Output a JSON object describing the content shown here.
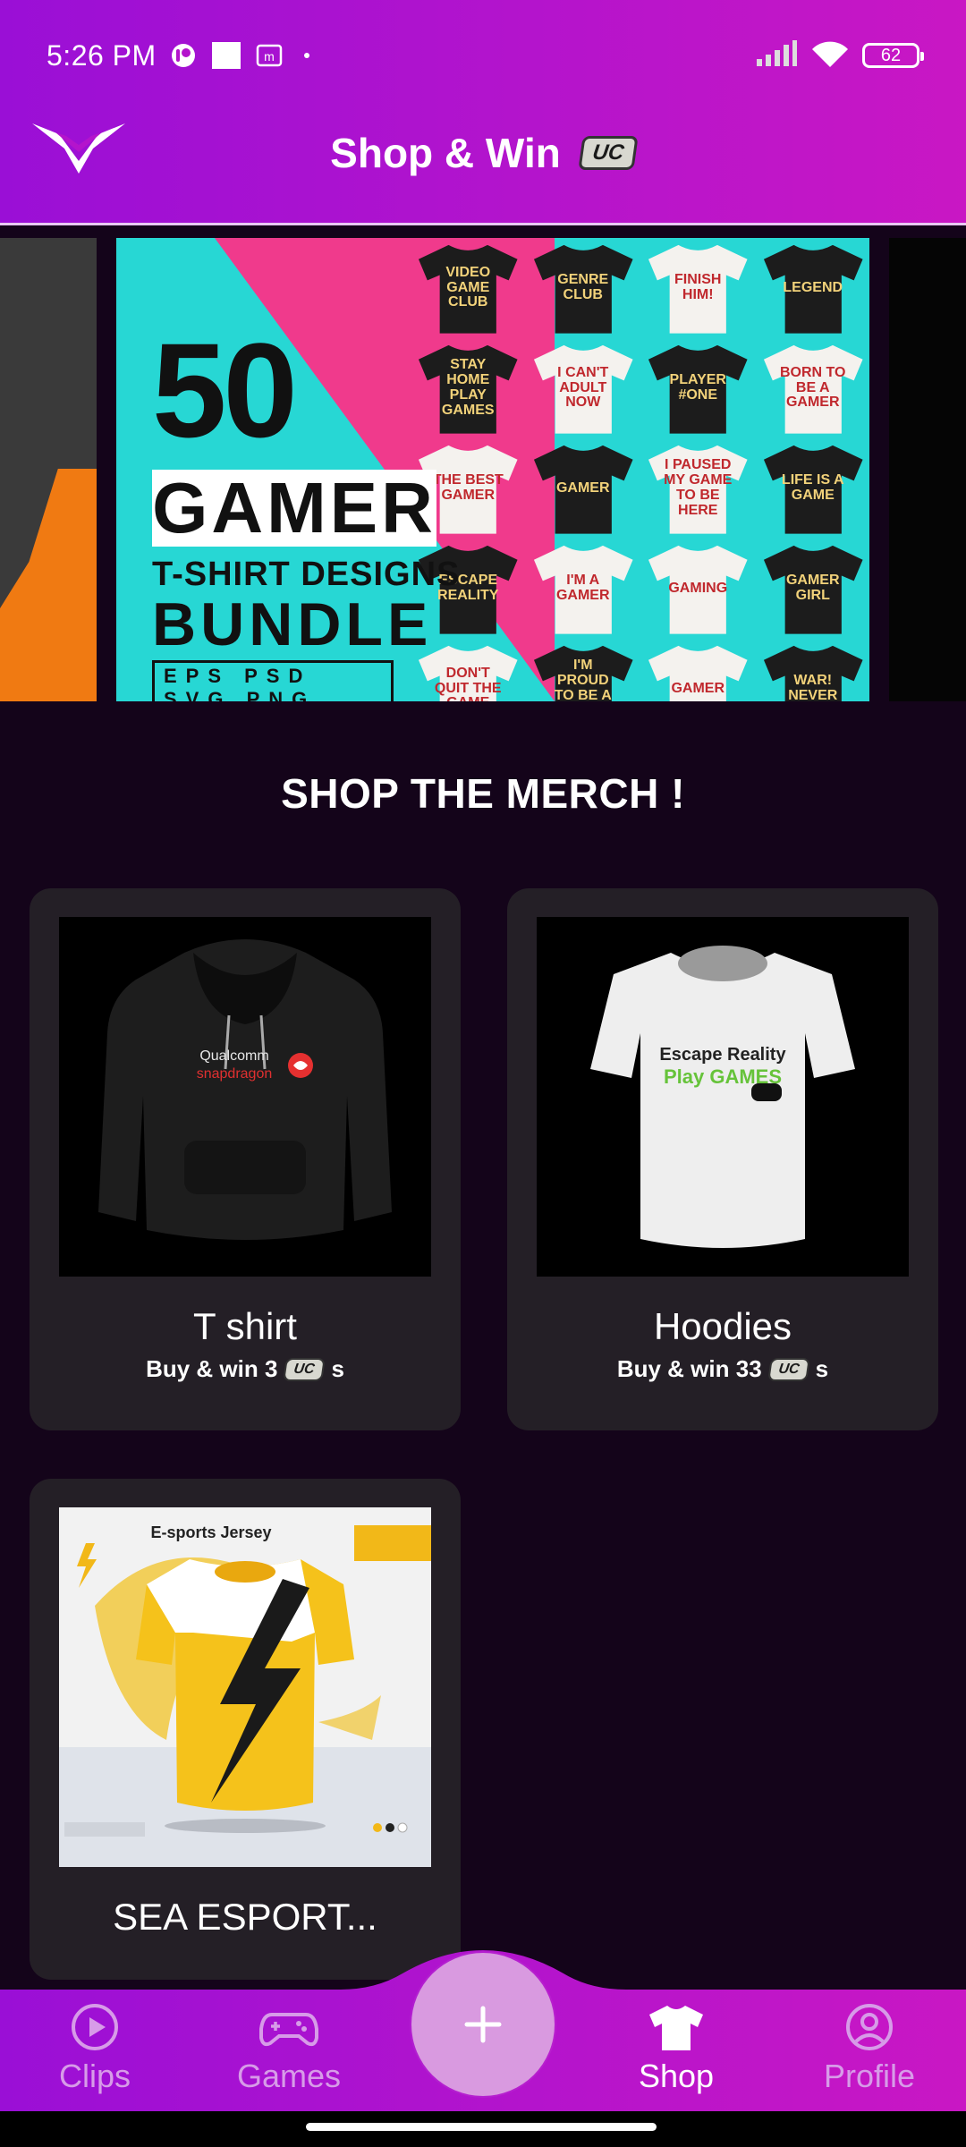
{
  "status_bar": {
    "time": "5:26 PM",
    "battery": "62"
  },
  "header": {
    "title": "Shop & Win",
    "badge": "UC"
  },
  "banner": {
    "number": "50",
    "word": "GAMER",
    "line1": "T-SHIRT DESIGNS",
    "line2": "BUNDLE",
    "formats": "EPS PSD SVG PNG",
    "shirts": [
      "VIDEO GAME CLUB",
      "GENRE CLUB",
      "FINISH HIM!",
      "LEGEND",
      "STAY HOME PLAY GAMES",
      "I CAN'T ADULT NOW",
      "PLAYER #ONE",
      "BORN TO BE A GAMER",
      "THE BEST GAMER",
      "GAMER",
      "I PAUSED MY GAME TO BE HERE",
      "LIFE IS A GAME",
      "ESCAPE REALITY",
      "I'M A GAMER",
      "GAMING",
      "GAMER GIRL",
      "DON'T QUIT THE GAME",
      "I'M PROUD TO BE A GAMER",
      "GAMER",
      "WAR! NEVER"
    ]
  },
  "section_title": "SHOP THE MERCH !",
  "products": [
    {
      "name": "T shirt",
      "price_prefix": "Buy & win 3",
      "price_suffix": "s",
      "badge": "UC",
      "art": "hoodie",
      "print_top": "Qualcomm",
      "print_bottom": "snapdragon"
    },
    {
      "name": "Hoodies",
      "price_prefix": "Buy & win 33",
      "price_suffix": "s",
      "badge": "UC",
      "art": "tshirt",
      "print_top": "Escape Reality",
      "print_bottom": "Play GAMES"
    },
    {
      "name": "SEA ESPORT...",
      "art": "jersey",
      "print_top": "E-sports Jersey"
    }
  ],
  "nav": [
    {
      "label": "Clips",
      "icon": "play-circle-icon",
      "active": false
    },
    {
      "label": "Games",
      "icon": "gamepad-icon",
      "active": false
    },
    {
      "label": "Shop",
      "icon": "shirt-icon",
      "active": true
    },
    {
      "label": "Profile",
      "icon": "user-circle-icon",
      "active": false
    }
  ],
  "colors": {
    "header_start": "#9a0fd6",
    "header_end": "#c917c4",
    "background": "#14041a",
    "card": "#241f26",
    "fab": "#d99ae0",
    "nav_inactive": "#d79be8"
  }
}
